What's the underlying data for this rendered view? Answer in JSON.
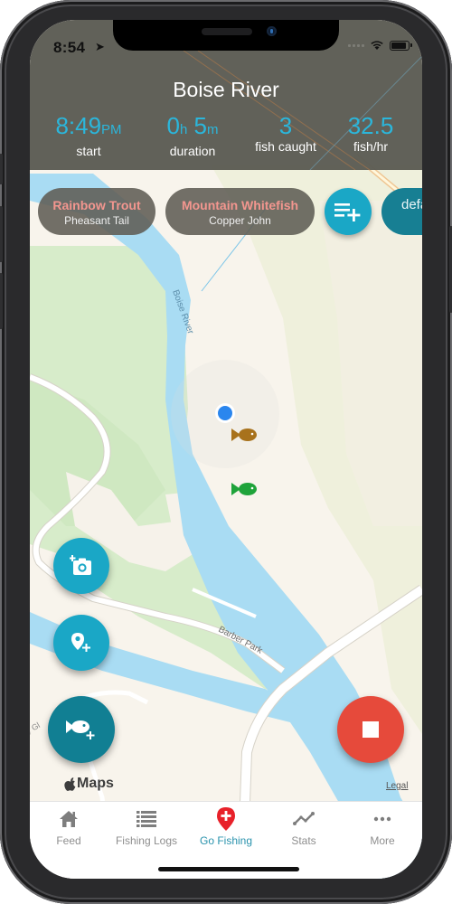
{
  "status_bar": {
    "time": "8:54",
    "location_icon": "location-arrow-icon",
    "wifi_icon": "wifi-icon",
    "battery_icon": "battery-icon"
  },
  "header": {
    "title": "Boise River",
    "stats": [
      {
        "value": "8:49",
        "unit": "PM",
        "label": "start"
      },
      {
        "value_h": "0",
        "unit_h": "h",
        "value_m": "5",
        "unit_m": "m",
        "label": "duration"
      },
      {
        "value": "3",
        "label": "fish caught"
      },
      {
        "value": "32.5",
        "label": "fish/hr"
      }
    ]
  },
  "chips": [
    {
      "species": "Rainbow Trout",
      "fly": "Pheasant Tail"
    },
    {
      "species": "Mountain Whitefish",
      "fly": "Copper John"
    }
  ],
  "add_chip_icon": "playlist-add-icon",
  "default_chip": {
    "label": "defa"
  },
  "map": {
    "labels": {
      "river": "Boise River",
      "park": "Barber Park",
      "road": "y Gl"
    },
    "user_location_icon": "user-location-dot-icon",
    "catches": [
      {
        "icon": "fish-marker-icon",
        "color": "#a8721c"
      },
      {
        "icon": "fish-marker-icon",
        "color": "#1fa33a"
      }
    ],
    "attribution": "Maps",
    "legal": "Legal"
  },
  "actions": {
    "add_photo_icon": "add-photo-icon",
    "add_spot_icon": "add-location-icon",
    "add_fish_icon": "add-fish-icon",
    "stop_icon": "stop-icon"
  },
  "colors": {
    "accent": "#1aa7c6",
    "accent_dark": "#117f93",
    "stop": "#e64a3b",
    "active_tab": "#2a93ad",
    "species_text": "#f3968f"
  },
  "tabbar": {
    "items": [
      {
        "label": "Feed",
        "icon": "home-icon",
        "active": false
      },
      {
        "label": "Fishing Logs",
        "icon": "list-icon",
        "active": false
      },
      {
        "label": "Go Fishing",
        "icon": "map-pin-plus-icon",
        "active": true
      },
      {
        "label": "Stats",
        "icon": "line-chart-icon",
        "active": false
      },
      {
        "label": "More",
        "icon": "more-dots-icon",
        "active": false
      }
    ]
  }
}
